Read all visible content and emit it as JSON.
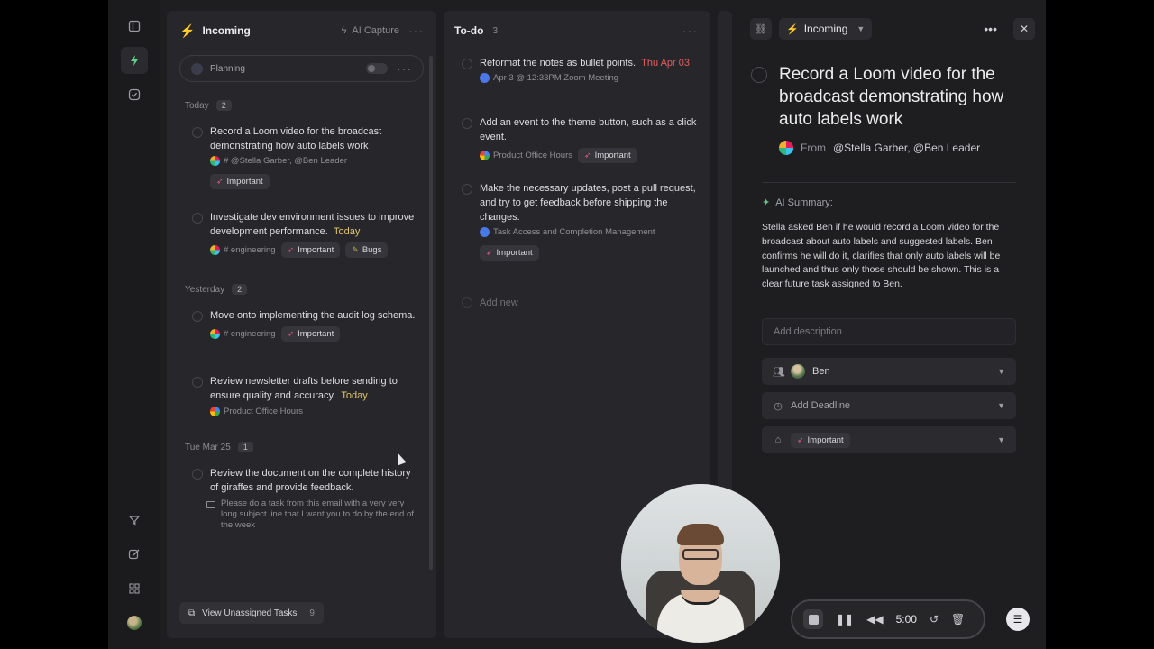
{
  "rail": {
    "items": [
      {
        "name": "sidebar-toggle-icon"
      },
      {
        "name": "bolt-icon"
      },
      {
        "name": "check-square-icon"
      },
      {
        "name": "filter-icon"
      },
      {
        "name": "edit-icon"
      },
      {
        "name": "grid-icon"
      }
    ]
  },
  "incoming": {
    "title": "Incoming",
    "ai_capture_label": "AI Capture",
    "planning_label": "Planning",
    "groups": [
      {
        "label": "Today",
        "count": "2",
        "tasks": [
          {
            "title": "Record a Loom video for the broadcast demonstrating how auto labels work",
            "source": "# @Stella Garber, @Ben Leader",
            "tags": [
              "Important"
            ]
          },
          {
            "title": "Investigate dev environment issues to improve development performance.",
            "due": "Today",
            "source": "# engineering",
            "tags": [
              "Important",
              "Bugs"
            ]
          }
        ]
      },
      {
        "label": "Yesterday",
        "count": "2",
        "tasks": [
          {
            "title": "Move onto implementing the audit log schema.",
            "source": "# engineering",
            "tags": [
              "Important"
            ]
          },
          {
            "title": "Review newsletter drafts before sending to ensure quality and accuracy.",
            "due": "Today",
            "source": "Product Office Hours"
          }
        ]
      },
      {
        "label": "Tue Mar 25",
        "count": "1",
        "tasks": [
          {
            "title": "Review the document on the complete history of giraffes and provide feedback.",
            "subtext": "Please do a task from this email with a very very long subject line that I want you to do by the end of the week"
          }
        ]
      }
    ],
    "view_unassigned_label": "View Unassigned Tasks",
    "view_unassigned_count": "9"
  },
  "todo": {
    "title": "To-do",
    "count": "3",
    "tasks": [
      {
        "title": "Reformat the notes as bullet points.",
        "due": "Thu Apr 03",
        "source": "Apr 3 @ 12:33PM Zoom Meeting"
      },
      {
        "title": "Add an event to the theme button, such as a click event.",
        "source": "Product Office Hours",
        "tags": [
          "Important"
        ]
      },
      {
        "title": "Make the necessary updates, post a pull request, and try to get feedback before shipping the changes.",
        "source": "Task Access and Completion Management",
        "tags": [
          "Important"
        ]
      }
    ],
    "add_new_label": "Add new"
  },
  "detail": {
    "status": "Incoming",
    "title": "Record a Loom video for the broadcast demonstrating how auto labels work",
    "from_label": "From",
    "from_people": "@Stella Garber, @Ben Leader",
    "ai_summary_label": "AI Summary:",
    "ai_summary": "Stella asked Ben if he would record a Loom video for the broadcast about auto labels and suggested labels. Ben confirms he will do it, clarifies that only auto labels will be launched and thus only those should be shown. This is a clear future task assigned to Ben.",
    "description_placeholder": "Add description",
    "assignee": "Ben",
    "deadline_label": "Add Deadline",
    "label_tag": "Important"
  },
  "recorder": {
    "timer": "5:00"
  },
  "colors": {
    "accent_bolt": "#f5b93a",
    "due_today": "#e2c768",
    "due_overdue": "#e45d5d",
    "important_icon": "#e0577a"
  }
}
